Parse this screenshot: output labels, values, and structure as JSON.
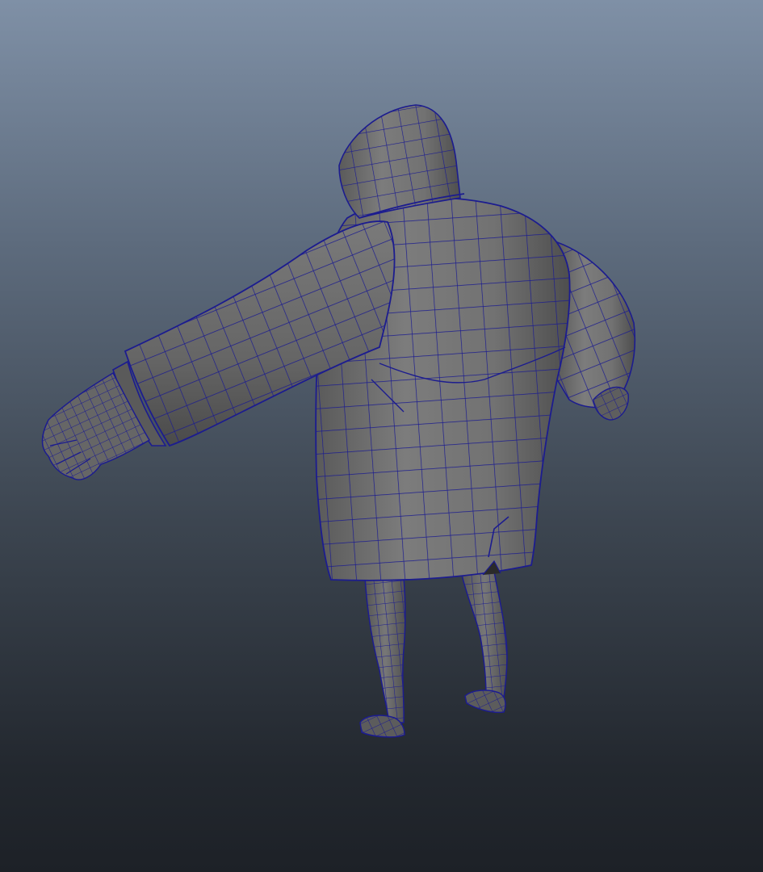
{
  "viewport": {
    "kind": "3d-modeling-viewport",
    "background_top": "#7f90a6",
    "background_bottom": "#1d2127"
  },
  "model": {
    "name": "character-mesh",
    "view": "perspective-rear",
    "shading": "smooth-shade-with-wireframe",
    "surface_color": "#6f6f6f",
    "wireframe_color": "#1a1a8c"
  }
}
